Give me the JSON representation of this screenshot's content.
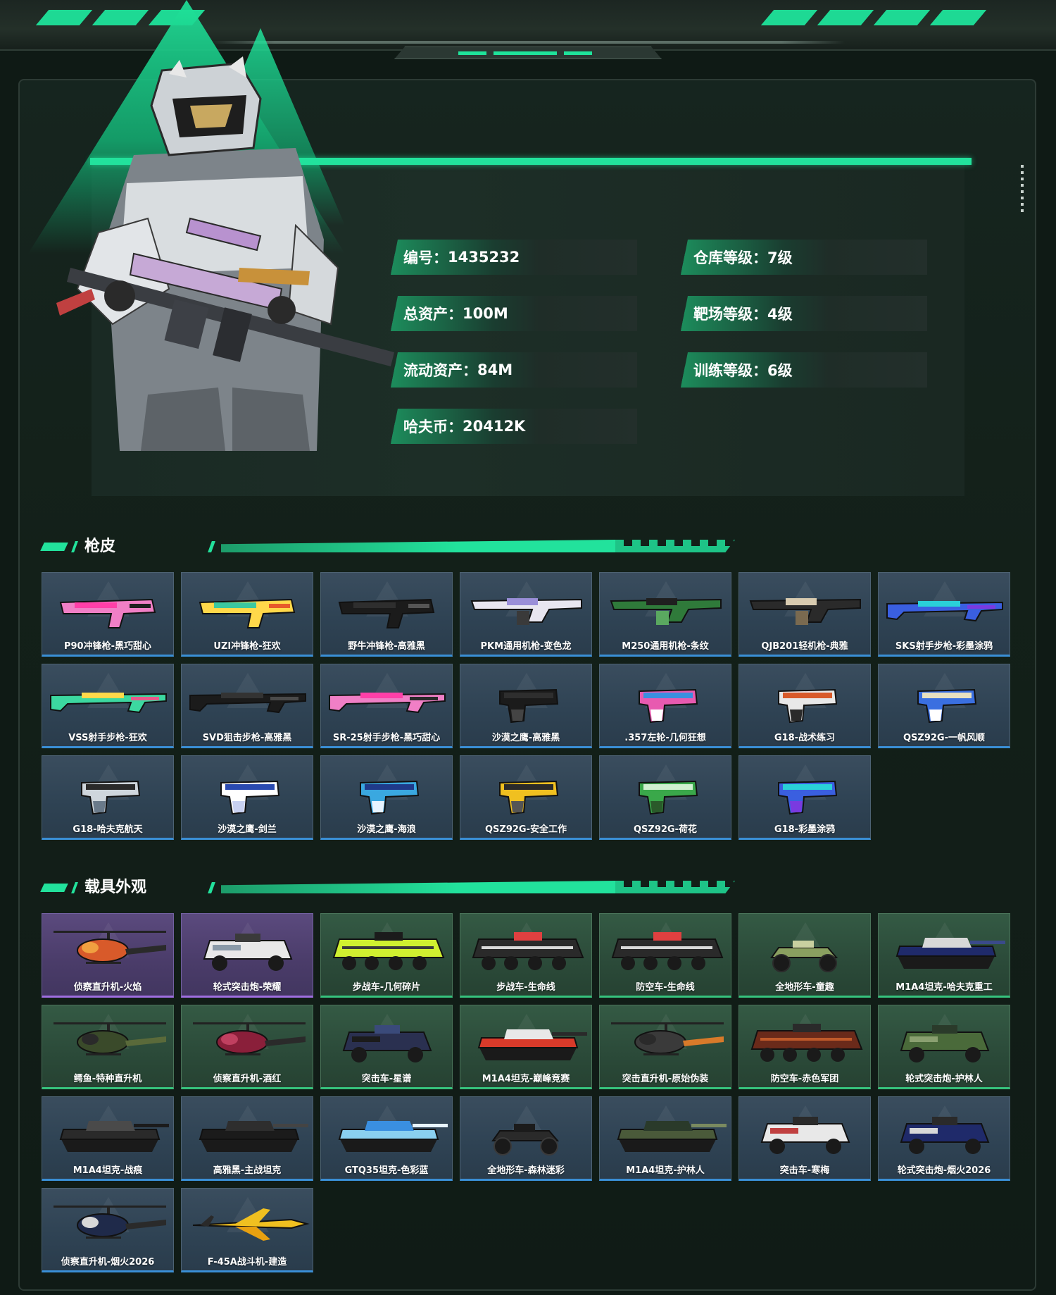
{
  "profile": {
    "stats": [
      {
        "label": "编号：",
        "value": "1435232"
      },
      {
        "label": "仓库等级：",
        "value": "7级"
      },
      {
        "label": "总资产：",
        "value": "100M"
      },
      {
        "label": "靶场等级：",
        "value": "4级"
      },
      {
        "label": "流动资产：",
        "value": "84M"
      },
      {
        "label": "训练等级：",
        "value": "6级"
      },
      {
        "label": "哈夫币：",
        "value": "20412K"
      }
    ]
  },
  "sections": {
    "gun_skins": {
      "title": "枪皮",
      "items": [
        {
          "name": "P90冲锋枪-黑巧甜心",
          "palette": [
            "#f07fc6",
            "#ff3fa8",
            "#1f1f1f"
          ],
          "kind": "smg"
        },
        {
          "name": "UZI冲锋枪-狂欢",
          "palette": [
            "#ffd84a",
            "#3cc8a0",
            "#e85a2a"
          ],
          "kind": "smg"
        },
        {
          "name": "野牛冲锋枪-高雅黑",
          "palette": [
            "#1b1b1b",
            "#2e2e2e",
            "#555555"
          ],
          "kind": "smg"
        },
        {
          "name": "PKM通用机枪-变色龙",
          "palette": [
            "#e8e6f0",
            "#9a8fd8",
            "#3a3a3a"
          ],
          "kind": "lmg"
        },
        {
          "name": "M250通用机枪-条纹",
          "palette": [
            "#2f7a3a",
            "#1f1f1f",
            "#5aa860"
          ],
          "kind": "lmg"
        },
        {
          "name": "QJB201轻机枪-典雅",
          "palette": [
            "#2a2a2a",
            "#d8cbb0",
            "#7a6a50"
          ],
          "kind": "lmg"
        },
        {
          "name": "SKS射手步枪-彩墨涂鸦",
          "palette": [
            "#3a5fe0",
            "#2ad0d8",
            "#7a3ae0"
          ],
          "kind": "rifle"
        },
        {
          "name": "VSS射手步枪-狂欢",
          "palette": [
            "#3cd8a0",
            "#ffd84a",
            "#e85a8a"
          ],
          "kind": "rifle"
        },
        {
          "name": "SVD狙击步枪-高雅黑",
          "palette": [
            "#1b1b1b",
            "#333333",
            "#4a4a4a"
          ],
          "kind": "rifle"
        },
        {
          "name": "SR-25射手步枪-黑巧甜心",
          "palette": [
            "#f07fc6",
            "#ff3fa8",
            "#2a2a2a"
          ],
          "kind": "rifle"
        },
        {
          "name": "沙漠之鹰-高雅黑",
          "palette": [
            "#1b1b1b",
            "#2e2e2e",
            "#444444"
          ],
          "kind": "pistol"
        },
        {
          "name": ".357左轮-几何狂想",
          "palette": [
            "#e85ab0",
            "#3a8fe0",
            "#ffffff"
          ],
          "kind": "pistol"
        },
        {
          "name": "G18-战术练习",
          "palette": [
            "#e8e8e8",
            "#d85a2a",
            "#2a2a2a"
          ],
          "kind": "pistol"
        },
        {
          "name": "QSZ92G-一帆风顺",
          "palette": [
            "#3a6fe0",
            "#e8e0c0",
            "#ffffff"
          ],
          "kind": "pistol"
        },
        {
          "name": "G18-哈夫克航天",
          "palette": [
            "#cfd6dc",
            "#2a2a2a",
            "#6a7a8a"
          ],
          "kind": "pistol"
        },
        {
          "name": "沙漠之鹰-剑兰",
          "palette": [
            "#ffffff",
            "#2a4ab0",
            "#c8d0f0"
          ],
          "kind": "pistol"
        },
        {
          "name": "沙漠之鹰-海浪",
          "palette": [
            "#3aa8e0",
            "#1f3a8a",
            "#e8f4ff"
          ],
          "kind": "pistol"
        },
        {
          "name": "QSZ92G-安全工作",
          "palette": [
            "#f0c020",
            "#2a2a2a",
            "#555555"
          ],
          "kind": "pistol"
        },
        {
          "name": "QSZ92G-荷花",
          "palette": [
            "#3aa84a",
            "#d0f0d0",
            "#2a5a2a"
          ],
          "kind": "pistol"
        },
        {
          "name": "G18-彩墨涂鸦",
          "palette": [
            "#3a5fe0",
            "#2ad0d8",
            "#7a3ae0"
          ],
          "kind": "pistol"
        }
      ]
    },
    "vehicle_skins": {
      "title": "载具外观",
      "items": [
        {
          "name": "侦察直升机-火焰",
          "palette": [
            "#d85a2a",
            "#2a2a2a",
            "#f0a040"
          ],
          "kind": "heli",
          "rarity": "purple"
        },
        {
          "name": "轮式突击炮-荣耀",
          "palette": [
            "#e8e8e8",
            "#3a3a3a",
            "#8a9aa8"
          ],
          "kind": "apc",
          "rarity": "purple"
        },
        {
          "name": "步战车-几何碎片",
          "palette": [
            "#d0f030",
            "#1b1b1b",
            "#3a3a3a"
          ],
          "kind": "ifv",
          "rarity": "green"
        },
        {
          "name": "步战车-生命线",
          "palette": [
            "#2a2a2a",
            "#e04040",
            "#d8d8d8"
          ],
          "kind": "ifv",
          "rarity": "green"
        },
        {
          "name": "防空车-生命线",
          "palette": [
            "#2a2a2a",
            "#e04040",
            "#d8d8d8"
          ],
          "kind": "ifv",
          "rarity": "green"
        },
        {
          "name": "全地形车-童趣",
          "palette": [
            "#8aa060",
            "#2a2a2a",
            "#c8d0a0"
          ],
          "kind": "atv",
          "rarity": "green"
        },
        {
          "name": "M1A4坦克-哈夫克重工",
          "palette": [
            "#1f2a6a",
            "#d8d8d8",
            "#3a4a8a"
          ],
          "kind": "tank",
          "rarity": "green"
        },
        {
          "name": "鳄鱼-特种直升机",
          "palette": [
            "#3a4a2a",
            "#5a6a3a",
            "#2a2a2a"
          ],
          "kind": "heli",
          "rarity": "green"
        },
        {
          "name": "侦察直升机-酒红",
          "palette": [
            "#8a1f3a",
            "#2a2a2a",
            "#c04060"
          ],
          "kind": "heli",
          "rarity": "green"
        },
        {
          "name": "突击车-星谱",
          "palette": [
            "#2a3050",
            "#3a4a7a",
            "#1b1b1b"
          ],
          "kind": "apc",
          "rarity": "green"
        },
        {
          "name": "M1A4坦克-巅峰竞赛",
          "palette": [
            "#d83a2a",
            "#e8e8e8",
            "#2a2a2a"
          ],
          "kind": "tank",
          "rarity": "green"
        },
        {
          "name": "突击直升机-原始伪装",
          "palette": [
            "#3a3a3a",
            "#d87a2a",
            "#2a2a2a"
          ],
          "kind": "heli",
          "rarity": "green"
        },
        {
          "name": "防空车-赤色军团",
          "palette": [
            "#6a2a1a",
            "#2a2a2a",
            "#c05a2a"
          ],
          "kind": "ifv",
          "rarity": "green"
        },
        {
          "name": "轮式突击炮-护林人",
          "palette": [
            "#4a6a3a",
            "#2a3a2a",
            "#8aa070"
          ],
          "kind": "apc",
          "rarity": "green"
        },
        {
          "name": "M1A4坦克-战痕",
          "palette": [
            "#2a2a2a",
            "#4a4a4a",
            "#1b1b1b"
          ],
          "kind": "tank",
          "rarity": "blue"
        },
        {
          "name": "高雅黑-主战坦克",
          "palette": [
            "#1b1b1b",
            "#2e2e2e",
            "#444444"
          ],
          "kind": "tank",
          "rarity": "blue"
        },
        {
          "name": "GTQ35坦克-色彩蓝",
          "palette": [
            "#8ad0f0",
            "#3a8fe0",
            "#e8f4ff"
          ],
          "kind": "tank",
          "rarity": "blue"
        },
        {
          "name": "全地形车-森林迷彩",
          "palette": [
            "#2a2a2a",
            "#3a3a3a",
            "#1b1b1b"
          ],
          "kind": "atv",
          "rarity": "blue"
        },
        {
          "name": "M1A4坦克-护林人",
          "palette": [
            "#4a5a3a",
            "#2a3a2a",
            "#7a8a60"
          ],
          "kind": "tank",
          "rarity": "blue"
        },
        {
          "name": "突击车-寒梅",
          "palette": [
            "#e8e8e8",
            "#2a2a2a",
            "#c04040"
          ],
          "kind": "apc",
          "rarity": "blue"
        },
        {
          "name": "轮式突击炮-烟火2026",
          "palette": [
            "#1f2a6a",
            "#2a2a2a",
            "#d8d8d8"
          ],
          "kind": "apc",
          "rarity": "blue"
        },
        {
          "name": "侦察直升机-烟火2026",
          "palette": [
            "#1f2a4a",
            "#2a2a2a",
            "#d8d8d8"
          ],
          "kind": "heli",
          "rarity": "blue"
        },
        {
          "name": "F-45A战斗机-建造",
          "palette": [
            "#f0c020",
            "#2a2a2a",
            "#e8a010"
          ],
          "kind": "jet",
          "rarity": "blue"
        }
      ]
    }
  }
}
